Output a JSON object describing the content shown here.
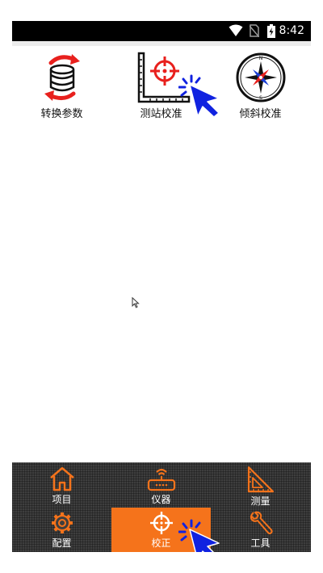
{
  "status_bar": {
    "time": "8:42",
    "icons": [
      "wifi-icon",
      "no-sim-icon",
      "battery-charging-icon"
    ]
  },
  "functions": [
    {
      "label": "转换参数",
      "icon": "database-convert-icon"
    },
    {
      "label": "测站校准",
      "icon": "station-calibration-icon"
    },
    {
      "label": "倾斜校准",
      "icon": "compass-icon"
    }
  ],
  "compass_letters": {
    "n": "N",
    "s": "S"
  },
  "nav": {
    "items": [
      {
        "label": "项目",
        "icon": "home-icon"
      },
      {
        "label": "仪器",
        "icon": "router-icon"
      },
      {
        "label": "测量",
        "icon": "triangle-ruler-icon"
      },
      {
        "label": "配置",
        "icon": "gear-icon"
      },
      {
        "label": "校正",
        "icon": "crosshair-icon"
      },
      {
        "label": "工具",
        "icon": "wrench-icon"
      }
    ],
    "active": "校正"
  },
  "colors": {
    "accent": "#f5731b",
    "nav_bg": "#3e3e3e",
    "icon_red": "#e8201d",
    "cursor_blue": "#1022e0"
  }
}
